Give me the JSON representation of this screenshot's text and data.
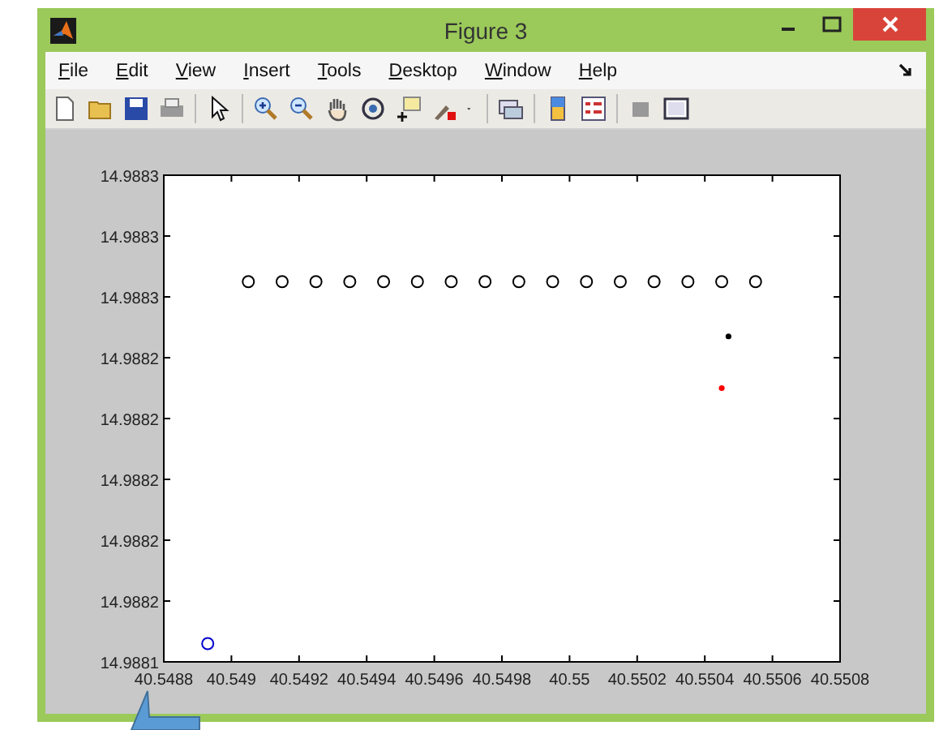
{
  "window": {
    "title": "Figure 3"
  },
  "menu": [
    "File",
    "Edit",
    "View",
    "Insert",
    "Tools",
    "Desktop",
    "Window",
    "Help"
  ],
  "figure": {
    "chart_data": {
      "type": "scatter",
      "xlim": [
        40.5488,
        40.5508
      ],
      "ylim": [
        14.98814,
        14.9883
      ],
      "xticks": [
        {
          "value": 40.5488,
          "label": "40.5488"
        },
        {
          "value": 40.549,
          "label": "40.549"
        },
        {
          "value": 40.5492,
          "label": "40.5492"
        },
        {
          "value": 40.5494,
          "label": "40.5494"
        },
        {
          "value": 40.5496,
          "label": "40.5496"
        },
        {
          "value": 40.5498,
          "label": "40.5498"
        },
        {
          "value": 40.55,
          "label": "40.55"
        },
        {
          "value": 40.5502,
          "label": "40.5502"
        },
        {
          "value": 40.5504,
          "label": "40.5504"
        },
        {
          "value": 40.5506,
          "label": "40.5506"
        },
        {
          "value": 40.5508,
          "label": "40.5508"
        }
      ],
      "yticks": [
        {
          "value": 14.98814,
          "label": "14.9881"
        },
        {
          "value": 14.98816,
          "label": "14.9882"
        },
        {
          "value": 14.98818,
          "label": "14.9882"
        },
        {
          "value": 14.9882,
          "label": "14.9882"
        },
        {
          "value": 14.98822,
          "label": "14.9882"
        },
        {
          "value": 14.98824,
          "label": "14.9882"
        },
        {
          "value": 14.98826,
          "label": "14.9883"
        },
        {
          "value": 14.98828,
          "label": "14.9883"
        },
        {
          "value": 14.9883,
          "label": "14.9883"
        }
      ],
      "series": [
        {
          "color": "#000000",
          "marker": "circle",
          "x": [
            40.54905,
            40.54915,
            40.54925,
            40.54935,
            40.54945,
            40.54955,
            40.54965,
            40.54975,
            40.54985,
            40.54995,
            40.55005,
            40.55015,
            40.55025,
            40.55035,
            40.55045,
            40.55055
          ],
          "values": [
            14.988265,
            14.988265,
            14.988265,
            14.988265,
            14.988265,
            14.988265,
            14.988265,
            14.988265,
            14.988265,
            14.988265,
            14.988265,
            14.988265,
            14.988265,
            14.988265,
            14.988265,
            14.988265
          ]
        },
        {
          "color": "#000000",
          "marker": "dot",
          "x": [
            40.55047
          ],
          "values": [
            14.988247
          ]
        },
        {
          "color": "#ff0000",
          "marker": "dot",
          "x": [
            40.55045
          ],
          "values": [
            14.98823
          ]
        },
        {
          "color": "#0000cc",
          "marker": "circle",
          "x": [
            40.54893
          ],
          "values": [
            14.988146
          ]
        }
      ]
    }
  }
}
